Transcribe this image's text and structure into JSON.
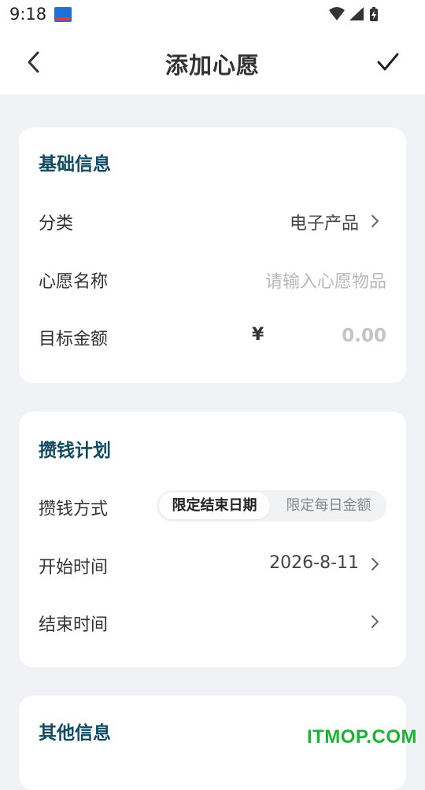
{
  "status_bar": {
    "time": "9:18",
    "icons": [
      "app-notification-icon",
      "wifi-icon",
      "signal-icon",
      "battery-charging-icon"
    ]
  },
  "header": {
    "back_icon": "chevron-left-icon",
    "title": "添加心愿",
    "confirm_icon": "checkmark-icon"
  },
  "basic_info": {
    "title": "基础信息",
    "category_label": "分类",
    "category_value": "电子产品",
    "name_label": "心愿名称",
    "name_placeholder": "请输入心愿物品",
    "amount_label": "目标金额",
    "currency": "¥",
    "amount_placeholder": "0.00"
  },
  "saving_plan": {
    "title": "攒钱计划",
    "method_label": "攒钱方式",
    "method_options": [
      "限定结束日期",
      "限定每日金额"
    ],
    "method_selected": "限定结束日期",
    "start_label": "开始时间",
    "start_value": "2026-8-11",
    "end_label": "结束时间",
    "end_value": ""
  },
  "other_info": {
    "title": "其他信息"
  },
  "watermark": "ITMOP.COM",
  "colors": {
    "section_title": "#0f4a63",
    "background": "#f1f2f6",
    "card": "#ffffff",
    "watermark": "#1db233"
  }
}
